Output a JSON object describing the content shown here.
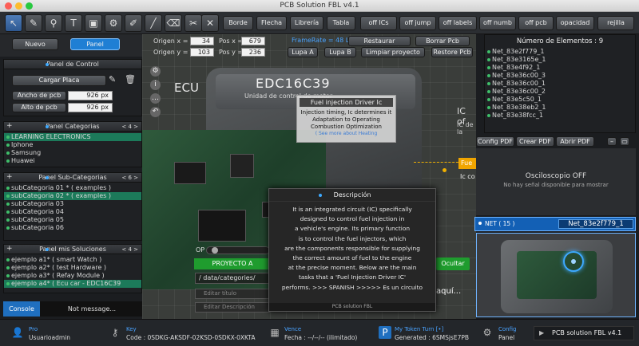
{
  "window": {
    "title": "PCB Solution FBL v4.1"
  },
  "toolbar": {
    "tools": [
      "pointer-icon",
      "pencil-icon",
      "pin-icon",
      "text-icon",
      "chip-icon",
      "component-icon",
      "brush-icon",
      "line-icon",
      "eraser-icon",
      "tool-icon"
    ],
    "buttons": {
      "borde": "Borde",
      "flecha": "Flecha",
      "libreria": "Librería",
      "tabla": "Tabla",
      "off_ics": "off ICs",
      "off_jump": "off jump",
      "off_labels": "off labels",
      "off_numb": "off numb",
      "off_pcb": "off pcb",
      "opacidad": "opacidad",
      "rejilla": "rejilla"
    }
  },
  "tabs": {
    "nuevo": "Nuevo",
    "panel": "Panel"
  },
  "coords": {
    "origen_x_label": "Origen x =",
    "origen_x": "34",
    "pos_x_label": "Pos x =",
    "pos_x": "679",
    "origen_y_label": "Origen y =",
    "origen_y": "103",
    "pos_y_label": "Pos y =",
    "pos_y": "236",
    "framerate": "FrameRate = 48 Loop"
  },
  "actions": {
    "restaurar": "Restaurar",
    "borrar_pcb": "Borrar Pcb",
    "lupa_a": "Lupa A",
    "lupa_b": "Lupa B",
    "limpiar": "Limpiar proyecto",
    "restore_pcb": "Restore Pcb"
  },
  "panel_control": {
    "title": "Panel de Control",
    "cargar": "Cargar Placa",
    "ancho_label": "Ancho de pcb",
    "ancho": "926 px",
    "alto_label": "Alto de pcb",
    "alto": "926 px"
  },
  "categorias": {
    "title": "Panel Categorias",
    "pager": "< 4 >",
    "items": [
      "LEARNING ELECTRONICS",
      "Iphone",
      "Samsung",
      "Huawei"
    ]
  },
  "subcategorias": {
    "title": "Panel Sub-Categorias",
    "pager": "< 6 >",
    "items": [
      "subCategoria 01 * ( examples )",
      "subCategoria 02 * ( examples )",
      "subCategoria 03",
      "subCategoria 04",
      "subCategoria 05",
      "subCategoria 06"
    ]
  },
  "soluciones": {
    "title": "Panel mis Soluciones",
    "pager": "< 4 >",
    "items": [
      "ejemplo a1* ( smart Watch )",
      "ejemplo a2* ( test Hardware )",
      "ejemplo a3* ( Refay Module )",
      "ejemplo a4* ( Ecu car - EDC16C39"
    ]
  },
  "console": {
    "tab": "Console",
    "message": "Not message..."
  },
  "canvas": {
    "ecu_label": "ECU",
    "model": "EDC16C39",
    "subtitle": "Unidad de control de motor",
    "ic_label": "IC of",
    "ic_sub": "IC de la",
    "fuel_box": "Fue",
    "ic_cont": "Ic co",
    "tooltip": {
      "title": "Fuel injection Driver Ic",
      "lines": [
        "Injection timing, Ic determines it",
        "Adaptation to Operating",
        "Combustion Optimization"
      ],
      "link": "( See more about Heating"
    },
    "op": "OP",
    "project_btn": "PROYECTO A",
    "ocultar": "Ocultar",
    "path": "/ data/categories/",
    "editar_titulo": "Editar título",
    "editar_desc": "Editar Descripción",
    "aqui": "aquí...",
    "agrega": "Agrega una descripción extra de su proyecto aquí ..."
  },
  "descripcion": {
    "title": "Descripción",
    "lines": [
      "It is an integrated circuit (IC) specifically",
      "designed to control fuel injection in",
      "a vehicle's engine. Its primary function",
      "is to control the fuel injectors, which",
      "are the components responsible for supplying",
      "the correct amount of fuel to the engine",
      "at the precise moment. Below are the main",
      "tasks that a 'Fuel Injection Driver IC'",
      "performs.  >>> SPANISH >>>>> Es un circuito"
    ],
    "footer": "PCB solution FBL"
  },
  "elementos": {
    "title": "Número de Elementos : 9",
    "items": [
      "Net_83e2f779_1",
      "Net_83e3165e_1",
      "Net_83e4f92_1",
      "Net_83e36c00_3",
      "Net_83e36c00_1",
      "Net_83e36c00_2",
      "Net_83e5c50_1",
      "Net_83e38eb2_1",
      "Net_83e38fcc_1"
    ]
  },
  "pdf": {
    "config": "Config PDF",
    "crear": "Crear PDF",
    "abrir": "Abrir PDF"
  },
  "osciloscopio": {
    "title": "Osciloscopio OFF",
    "sub": "No hay señal disponible para mostrar"
  },
  "net": {
    "count": "NET ( 15 )",
    "name": "Net_83e2f779_1"
  },
  "status": {
    "pro_label": "Pro",
    "pro_val": "Usuarioadmin",
    "key_label": "Key",
    "key_val": "Code : 0SDKG-AKSDF-02KSD-0SDKX-0XKTA",
    "vence_label": "Vence",
    "vence_val": "Fecha : --/--/-- (ilimitado)",
    "token_label": "My Token Turn  [•]",
    "token_val": "Generated : 6SMSjsE7PB",
    "config_label": "Config",
    "config_val": "Panel",
    "app": "PCB solution FBL v4.1"
  }
}
